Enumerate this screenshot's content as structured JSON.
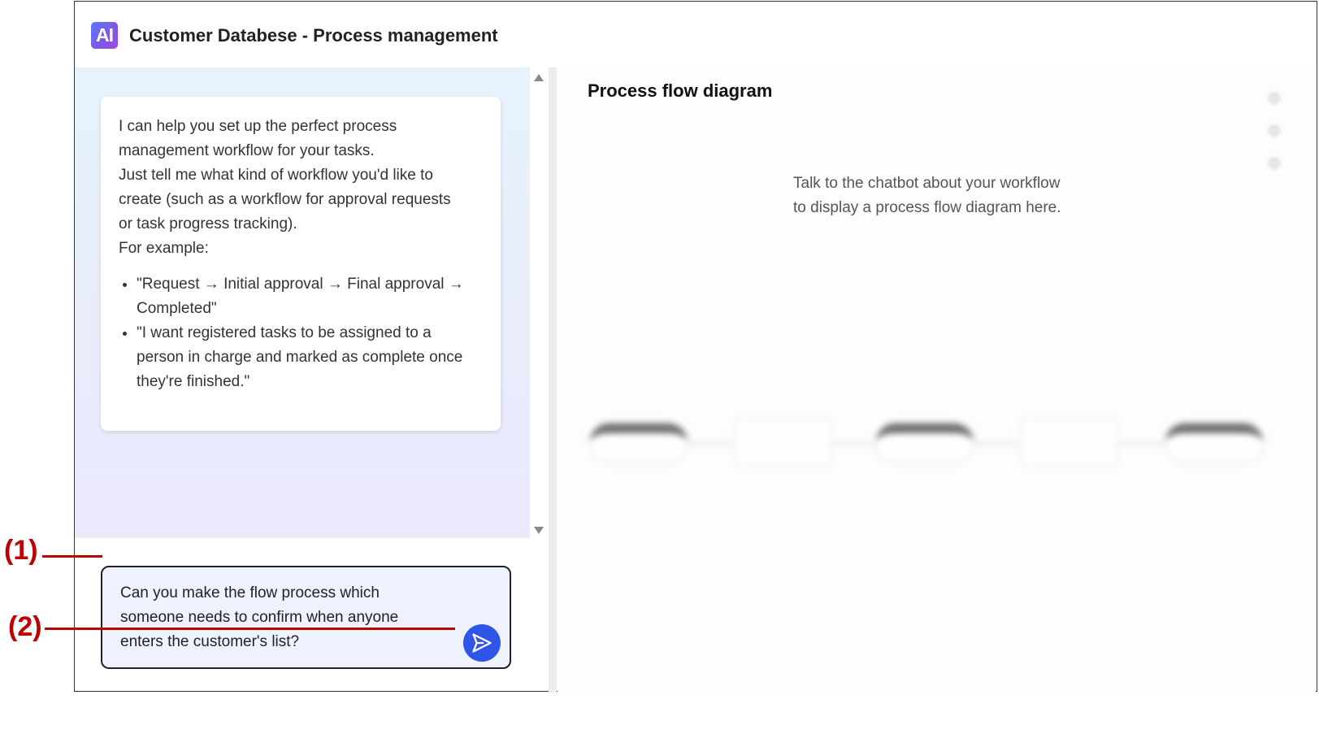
{
  "window": {
    "logo_text": "AI",
    "title": "Customer Databese - Process management"
  },
  "chat": {
    "bot_message": {
      "line1": "I can help you set up the perfect process",
      "line2": "management workflow for your tasks.",
      "line3": "Just tell me what kind of workflow you'd like to",
      "line4": "create (such as a workflow for approval requests",
      "line5": "or task progress tracking).",
      "line6": "For example:",
      "examples": [
        "\"Request → Initial approval → Final approval → Completed\"",
        "\"I want registered tasks to be assigned to a person in charge and marked as complete once they're finished.\""
      ]
    },
    "input_value": "Can you make the flow process which someone needs to confirm when anyone enters the customer's list?"
  },
  "diagram": {
    "title": "Process flow diagram",
    "hint_line1": "Talk to the chatbot about your workflow",
    "hint_line2": "to display a process flow diagram here."
  },
  "annotations": {
    "label1": "(1)",
    "label2": "(2)"
  },
  "colors": {
    "accent": "#2f55e8",
    "callout": "#c00000",
    "logo_gradient_start": "#5b7cf5",
    "logo_gradient_end": "#9b4fe0"
  },
  "icons": {
    "send": "send-arrow-icon",
    "scroll_up": "scroll-up-icon",
    "scroll_down": "scroll-down-icon"
  }
}
